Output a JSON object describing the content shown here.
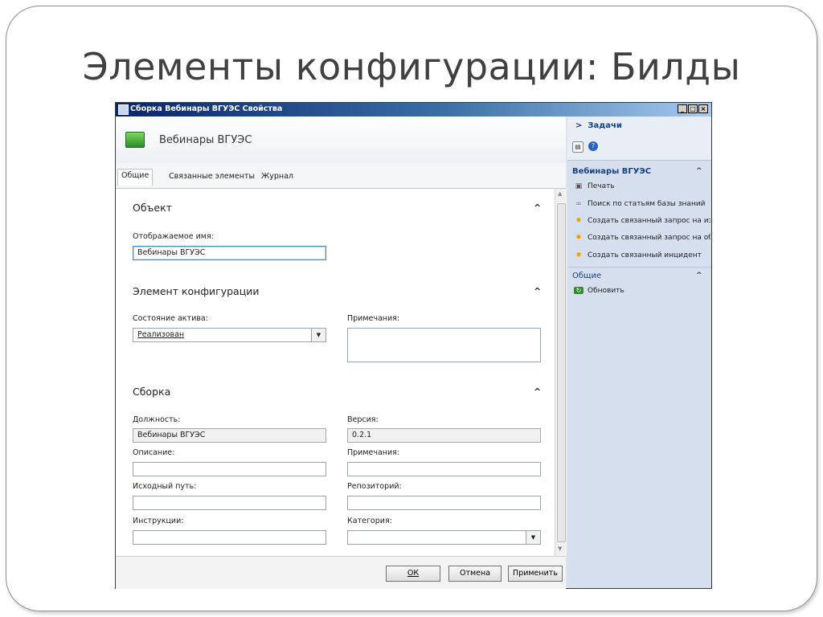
{
  "slide": {
    "title": "Элементы конфигурации: Билды"
  },
  "window": {
    "title": "Сборка Вебинары ВГУЭС Свойства",
    "controls": {
      "minimize": "_",
      "maximize": "□",
      "close": "×"
    },
    "header_title": "Вебинары ВГУЭС",
    "tabs": [
      {
        "label": "Общие"
      },
      {
        "label": "Связанные элементы"
      },
      {
        "label": "Журнал"
      }
    ],
    "sections": {
      "object": {
        "title": "Объект",
        "display_name_label": "Отображаемое имя:",
        "display_name_value": "Вебинары ВГУЭС"
      },
      "config_item": {
        "title": "Элемент конфигурации",
        "asset_state_label": "Состояние актива:",
        "asset_state_value": "Реализован",
        "notes_label": "Примечания:",
        "notes_value": ""
      },
      "build": {
        "title": "Сборка",
        "position_label": "Должность:",
        "position_value": "Вебинары ВГУЭС",
        "version_label": "Версия:",
        "version_value": "0.2.1",
        "description_label": "Описание:",
        "description_value": "",
        "notes_label": "Примечания:",
        "notes_value": "",
        "source_path_label": "Исходный путь:",
        "source_path_value": "",
        "repository_label": "Репозиторий:",
        "repository_value": "",
        "instructions_label": "Инструкции:",
        "instructions_value": "",
        "category_label": "Категория:",
        "category_value": ""
      }
    },
    "buttons": {
      "ok": "ОК",
      "cancel": "Отмена",
      "apply": "Применить"
    },
    "tasks_pane": {
      "header": "Задачи",
      "header_arrow": ">",
      "section1_title": "Вебинары ВГУЭС",
      "section1_items": [
        {
          "label": "Печать",
          "icon": "printer-icon"
        },
        {
          "label": "Поиск по статьям базы знаний",
          "icon": "link-icon"
        },
        {
          "label": "Создать связанный запрос на изменение",
          "icon": "star-icon"
        },
        {
          "label": "Создать связанный запрос на обслуживание",
          "icon": "star-icon"
        },
        {
          "label": "Создать связанный инцидент",
          "icon": "star-icon"
        }
      ],
      "section2_title": "Общие",
      "section2_items": [
        {
          "label": "Обновить",
          "icon": "refresh-icon"
        }
      ]
    }
  }
}
